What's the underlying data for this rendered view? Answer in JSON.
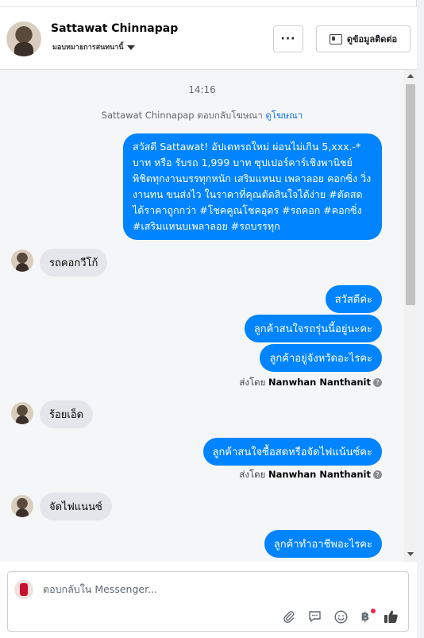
{
  "header": {
    "name": "Sattawat Chinnapap",
    "assign_label": "มอบหมายการสนทนานี้",
    "more_label": "···",
    "contact_label": "ดูข้อมูลติดต่อ"
  },
  "thread": {
    "time": "14:16",
    "replied_text": "Sattawat Chinnapap ตอบกลับโฆษณา",
    "replied_link": "ดูโฆษณา",
    "ad_message": "สวัสดี Sattawat! อัปเดทรถใหม่ ผ่อนไม่เกิน 5,xxx.-* บาท  หรือ รับรถ 1,999 บาท ซุปเปอร์คาร์เชิงพานิชย์ พิชิตทุกงานบรรทุกหนัก เสริมแหนบ เพลาลอย คอกซิ่ง วิ่งงานทน ขนส่งไว ในราคาที่คุณตัดสินใจได้ง่าย #ตัดสดได้ราคาถูกกว่า #โชคคูณโชคอุดร #รถคอก #คอกซิ่ง #เสริมแหนบเพลาลอย #รถบรรทุก",
    "msg_in_1": "รถคอกวีโก้",
    "msg_out_1": "สวัสดีค่ะ",
    "msg_out_2": "ลูกค้าสนใจรถรุ่นนี้อยู่นะคะ",
    "msg_out_3": "ลูกค้าอยู่จังหวัดอะไรคะ",
    "sent_by_prefix": "ส่งโดย",
    "sent_by_name": "Nanwhan Nanthanit",
    "msg_in_2": "ร้อยเอ็ด",
    "msg_out_4": "ลูกค้าสนใจซื้อสดหรือจัดไฟแน้นซ์คะ",
    "msg_in_3": "จัดไฟแนนซ์",
    "msg_out_5": "ลูกค้าทำอาชีพอะไรคะ"
  },
  "composer": {
    "placeholder": "ตอบกลับใน Messenger..."
  },
  "colors": {
    "outgoing_bubble": "#0084ff",
    "incoming_bubble": "#e4e6eb",
    "link": "#1877f2"
  },
  "icons": [
    "chevron-down-icon",
    "more-icon",
    "contact-card-icon",
    "info-icon",
    "attachment-icon",
    "sticker-icon",
    "emoji-icon",
    "baht-icon",
    "like-icon"
  ]
}
